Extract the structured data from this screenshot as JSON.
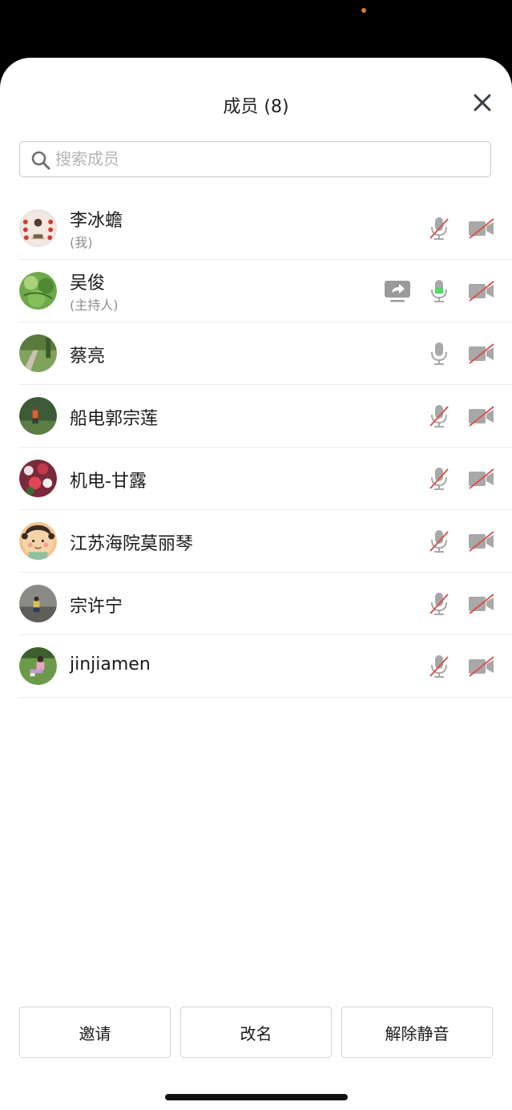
{
  "header": {
    "title": "成员 (8)"
  },
  "search": {
    "placeholder": "搜索成员"
  },
  "members": [
    {
      "name": "李冰蟾",
      "role": "(我)",
      "mic": "muted",
      "camera": "off",
      "sharing": false
    },
    {
      "name": "吴俊",
      "role": "(主持人)",
      "mic": "active",
      "camera": "off",
      "sharing": true
    },
    {
      "name": "蔡亮",
      "role": "",
      "mic": "on",
      "camera": "off",
      "sharing": false
    },
    {
      "name": "船电郭宗莲",
      "role": "",
      "mic": "muted",
      "camera": "off",
      "sharing": false
    },
    {
      "name": "机电-甘露",
      "role": "",
      "mic": "muted",
      "camera": "off",
      "sharing": false
    },
    {
      "name": "江苏海院莫丽琴",
      "role": "",
      "mic": "muted",
      "camera": "off",
      "sharing": false
    },
    {
      "name": "宗许宁",
      "role": "",
      "mic": "muted",
      "camera": "off",
      "sharing": false
    },
    {
      "name": "jinjiamen",
      "role": "",
      "mic": "muted",
      "camera": "off",
      "sharing": false
    }
  ],
  "actions": {
    "invite_label": "邀请",
    "rename_label": "改名",
    "unmute_label": "解除静音"
  },
  "icons": {
    "close": "close-icon",
    "search": "search-icon",
    "mic": "microphone-icon",
    "mic_muted": "microphone-muted-icon",
    "camera_off": "camera-off-icon",
    "share": "screen-share-icon"
  },
  "colors": {
    "muted_slash": "#d9534f",
    "mic_active": "#4cd964",
    "icon_gray": "#9a9a9a"
  }
}
